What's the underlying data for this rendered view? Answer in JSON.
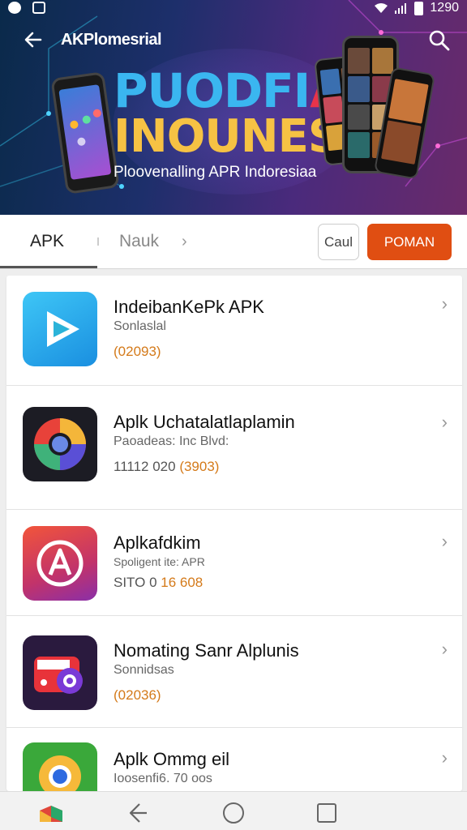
{
  "status_bar": {
    "time": "1290"
  },
  "header": {
    "title": "AKPlomesrial",
    "hero_line1_a": "PUODFI",
    "hero_line1_b": "A",
    "hero_line2": "INOUNESIA",
    "hero_subtitle": "Ploovenalling APR Indoresiaa"
  },
  "tabs": {
    "items": [
      {
        "label": "APK",
        "active": true
      },
      {
        "label": "Nauk",
        "active": false
      }
    ],
    "secondary_button": "Caul",
    "primary_button": "POMAN",
    "accent_color": "#e04e12"
  },
  "apps": [
    {
      "name": "IndeibanKePk APK",
      "subtitle": "Sonlaslal",
      "meta_plain": "",
      "meta_accent": "(02093)",
      "icon": "play-icon"
    },
    {
      "name": "Aplk Uchatalatlaplamin",
      "subtitle": "Paoadeas: Inc Blvd:",
      "meta_plain": "11112 020 ",
      "meta_accent": "(3903)",
      "icon": "browser-icon"
    },
    {
      "name": "Aplkafdkim",
      "subtitle": "Spoligent ite: APR",
      "meta_plain": "SITO 0 ",
      "meta_accent": "16 608",
      "icon": "letter-a-icon"
    },
    {
      "name": "Nomating Sanr Alplunis",
      "subtitle": "Sonnidsas",
      "meta_plain": "",
      "meta_accent": "(02036)",
      "icon": "camera-badge-icon"
    },
    {
      "name": "Aplk Ommg   eil",
      "subtitle": "Ioosenfi6. 70 oos",
      "meta_plain": "",
      "meta_accent": "",
      "icon": "chrome-like-icon"
    }
  ]
}
